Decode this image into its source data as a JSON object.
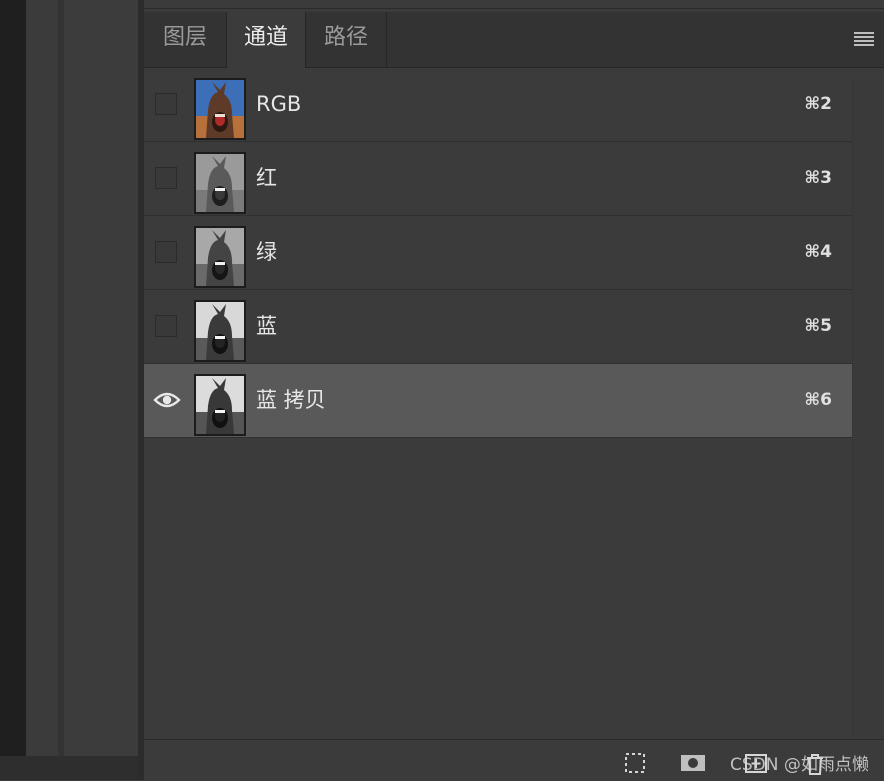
{
  "tabs": [
    {
      "label": "图层",
      "active": false
    },
    {
      "label": "通道",
      "active": true
    },
    {
      "label": "路径",
      "active": false
    }
  ],
  "channels": [
    {
      "name": "RGB",
      "shortcut": "⌘2",
      "visible": false,
      "selected": false,
      "thumbnail": "color"
    },
    {
      "name": "红",
      "shortcut": "⌘3",
      "visible": false,
      "selected": false,
      "thumbnail": "grayscale"
    },
    {
      "name": "绿",
      "shortcut": "⌘4",
      "visible": false,
      "selected": false,
      "thumbnail": "grayscale"
    },
    {
      "name": "蓝",
      "shortcut": "⌘5",
      "visible": false,
      "selected": false,
      "thumbnail": "grayscale"
    },
    {
      "name": "蓝 拷贝",
      "shortcut": "⌘6",
      "visible": true,
      "selected": true,
      "thumbnail": "grayscale"
    }
  ],
  "icons": {
    "panel_menu": "hamburger-menu-icon",
    "visibility": "eye-icon",
    "footer": [
      "load-selection-icon",
      "save-selection-icon",
      "new-channel-icon",
      "delete-channel-icon"
    ]
  },
  "watermark": "CSDN @如雨点懒",
  "colors": {
    "panel_bg": "#3b3b3b",
    "selected_row": "#595959",
    "tab_bar": "#333333"
  }
}
